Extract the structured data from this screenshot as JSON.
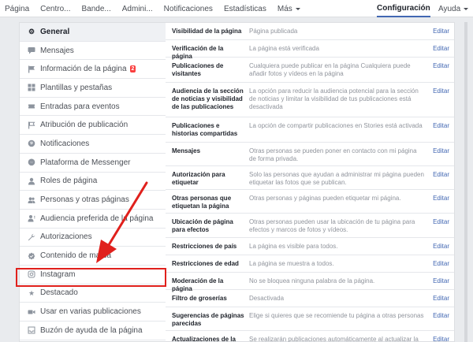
{
  "topnav": {
    "items": [
      "Página",
      "Centro...",
      "Bande...",
      "Admini...",
      "Notificaciones",
      "Estadísticas"
    ],
    "more": "Más",
    "config": "Configuración",
    "help": "Ayuda"
  },
  "sidebar": {
    "items": [
      {
        "label": "General",
        "icon": "gear-icon"
      },
      {
        "label": "Mensajes",
        "icon": "chat-icon"
      },
      {
        "label": "Información de la página",
        "icon": "flag-icon",
        "badge": "2"
      },
      {
        "label": "Plantillas y pestañas",
        "icon": "grid-icon"
      },
      {
        "label": "Entradas para eventos",
        "icon": "ticket-icon"
      },
      {
        "label": "Atribución de publicación",
        "icon": "flag-outline-icon"
      },
      {
        "label": "Notificaciones",
        "icon": "globe-icon"
      },
      {
        "label": "Plataforma de Messenger",
        "icon": "messenger-icon"
      },
      {
        "label": "Roles de página",
        "icon": "person-icon"
      },
      {
        "label": "Personas y otras páginas",
        "icon": "people-icon"
      },
      {
        "label": "Audiencia preferida de la página",
        "icon": "audience-icon"
      },
      {
        "label": "Autorizaciones",
        "icon": "wrench-icon"
      },
      {
        "label": "Contenido de marca",
        "icon": "badge-check-icon"
      },
      {
        "label": "Instagram",
        "icon": "instagram-icon"
      },
      {
        "label": "Destacado",
        "icon": "star-icon"
      },
      {
        "label": "Usar en varias publicaciones",
        "icon": "video-icon"
      },
      {
        "label": "Buzón de ayuda de la página",
        "icon": "inbox-icon"
      }
    ]
  },
  "settings": {
    "edit_label": "Editar",
    "rows": [
      {
        "label": "Visibilidad de la página",
        "value": "Página publicada"
      },
      {
        "label": "Verificación de la página",
        "value": "La página está verificada"
      },
      {
        "label": "Publicaciones de visitantes",
        "value": "Cualquiera puede publicar en la página Cualquiera puede añadir fotos y vídeos en la página"
      },
      {
        "label": "Audiencia de la sección de noticias y visibilidad de las publicaciones",
        "value": "La opción para reducir la audiencia potencial para la sección de noticias y limitar la visibilidad de tus publicaciones está desactivada"
      },
      {
        "label": "Publicaciones e historias compartidas",
        "value": "La opción de compartir publicaciones en Stories está activada"
      },
      {
        "label": "Mensajes",
        "value": "Otras personas se pueden poner en contacto con mi página de forma privada."
      },
      {
        "label": "Autorización para etiquetar",
        "value": "Solo las personas que ayudan a administrar mi página pueden etiquetar las fotos que se publican."
      },
      {
        "label": "Otras personas que etiquetan la página",
        "value": "Otras personas y páginas pueden etiquetar mi página."
      },
      {
        "label": "Ubicación de página para efectos",
        "value": "Otras personas pueden usar la ubicación de tu página para efectos y marcos de fotos y vídeos."
      },
      {
        "label": "Restricciones de país",
        "value": "La página es visible para todos."
      },
      {
        "label": "Restricciones de edad",
        "value": "La página se muestra a todos."
      },
      {
        "label": "Moderación de la página",
        "value": "No se bloquea ninguna palabra de la página."
      },
      {
        "label": "Filtro de groserías",
        "value": "Desactivada"
      },
      {
        "label": "Sugerencias de páginas parecidas",
        "value": "Elige si quieres que se recomiende tu página a otras personas"
      },
      {
        "label": "Actualizaciones de la página",
        "value": "Se realizarán publicaciones automáticamente al actualizar la"
      }
    ]
  },
  "colors": {
    "highlight": "#e0201c",
    "link": "#4267b2"
  }
}
